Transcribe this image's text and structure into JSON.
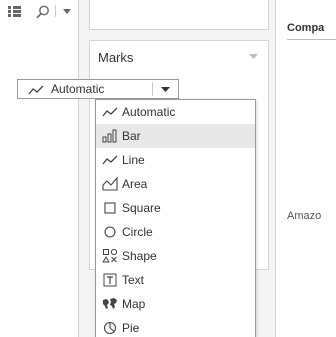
{
  "toolbar": {
    "icons": [
      "list-view-icon",
      "search-icon",
      "dropdown-caret-icon"
    ]
  },
  "marks_card": {
    "title": "Marks",
    "selected_mark": "Automatic"
  },
  "mark_type_menu": {
    "items": [
      {
        "label": "Automatic",
        "icon": "automatic-line-icon",
        "selected": false
      },
      {
        "label": "Bar",
        "icon": "bar-chart-icon",
        "selected": true
      },
      {
        "label": "Line",
        "icon": "line-chart-icon",
        "selected": false
      },
      {
        "label": "Area",
        "icon": "area-chart-icon",
        "selected": false
      },
      {
        "label": "Square",
        "icon": "square-icon",
        "selected": false
      },
      {
        "label": "Circle",
        "icon": "circle-icon",
        "selected": false
      },
      {
        "label": "Shape",
        "icon": "shape-icon",
        "selected": false
      },
      {
        "label": "Text",
        "icon": "text-icon",
        "selected": false
      },
      {
        "label": "Map",
        "icon": "map-icon",
        "selected": false
      },
      {
        "label": "Pie",
        "icon": "pie-icon",
        "selected": false
      }
    ]
  },
  "view": {
    "header": "Compa",
    "row_label": "Amazo"
  }
}
